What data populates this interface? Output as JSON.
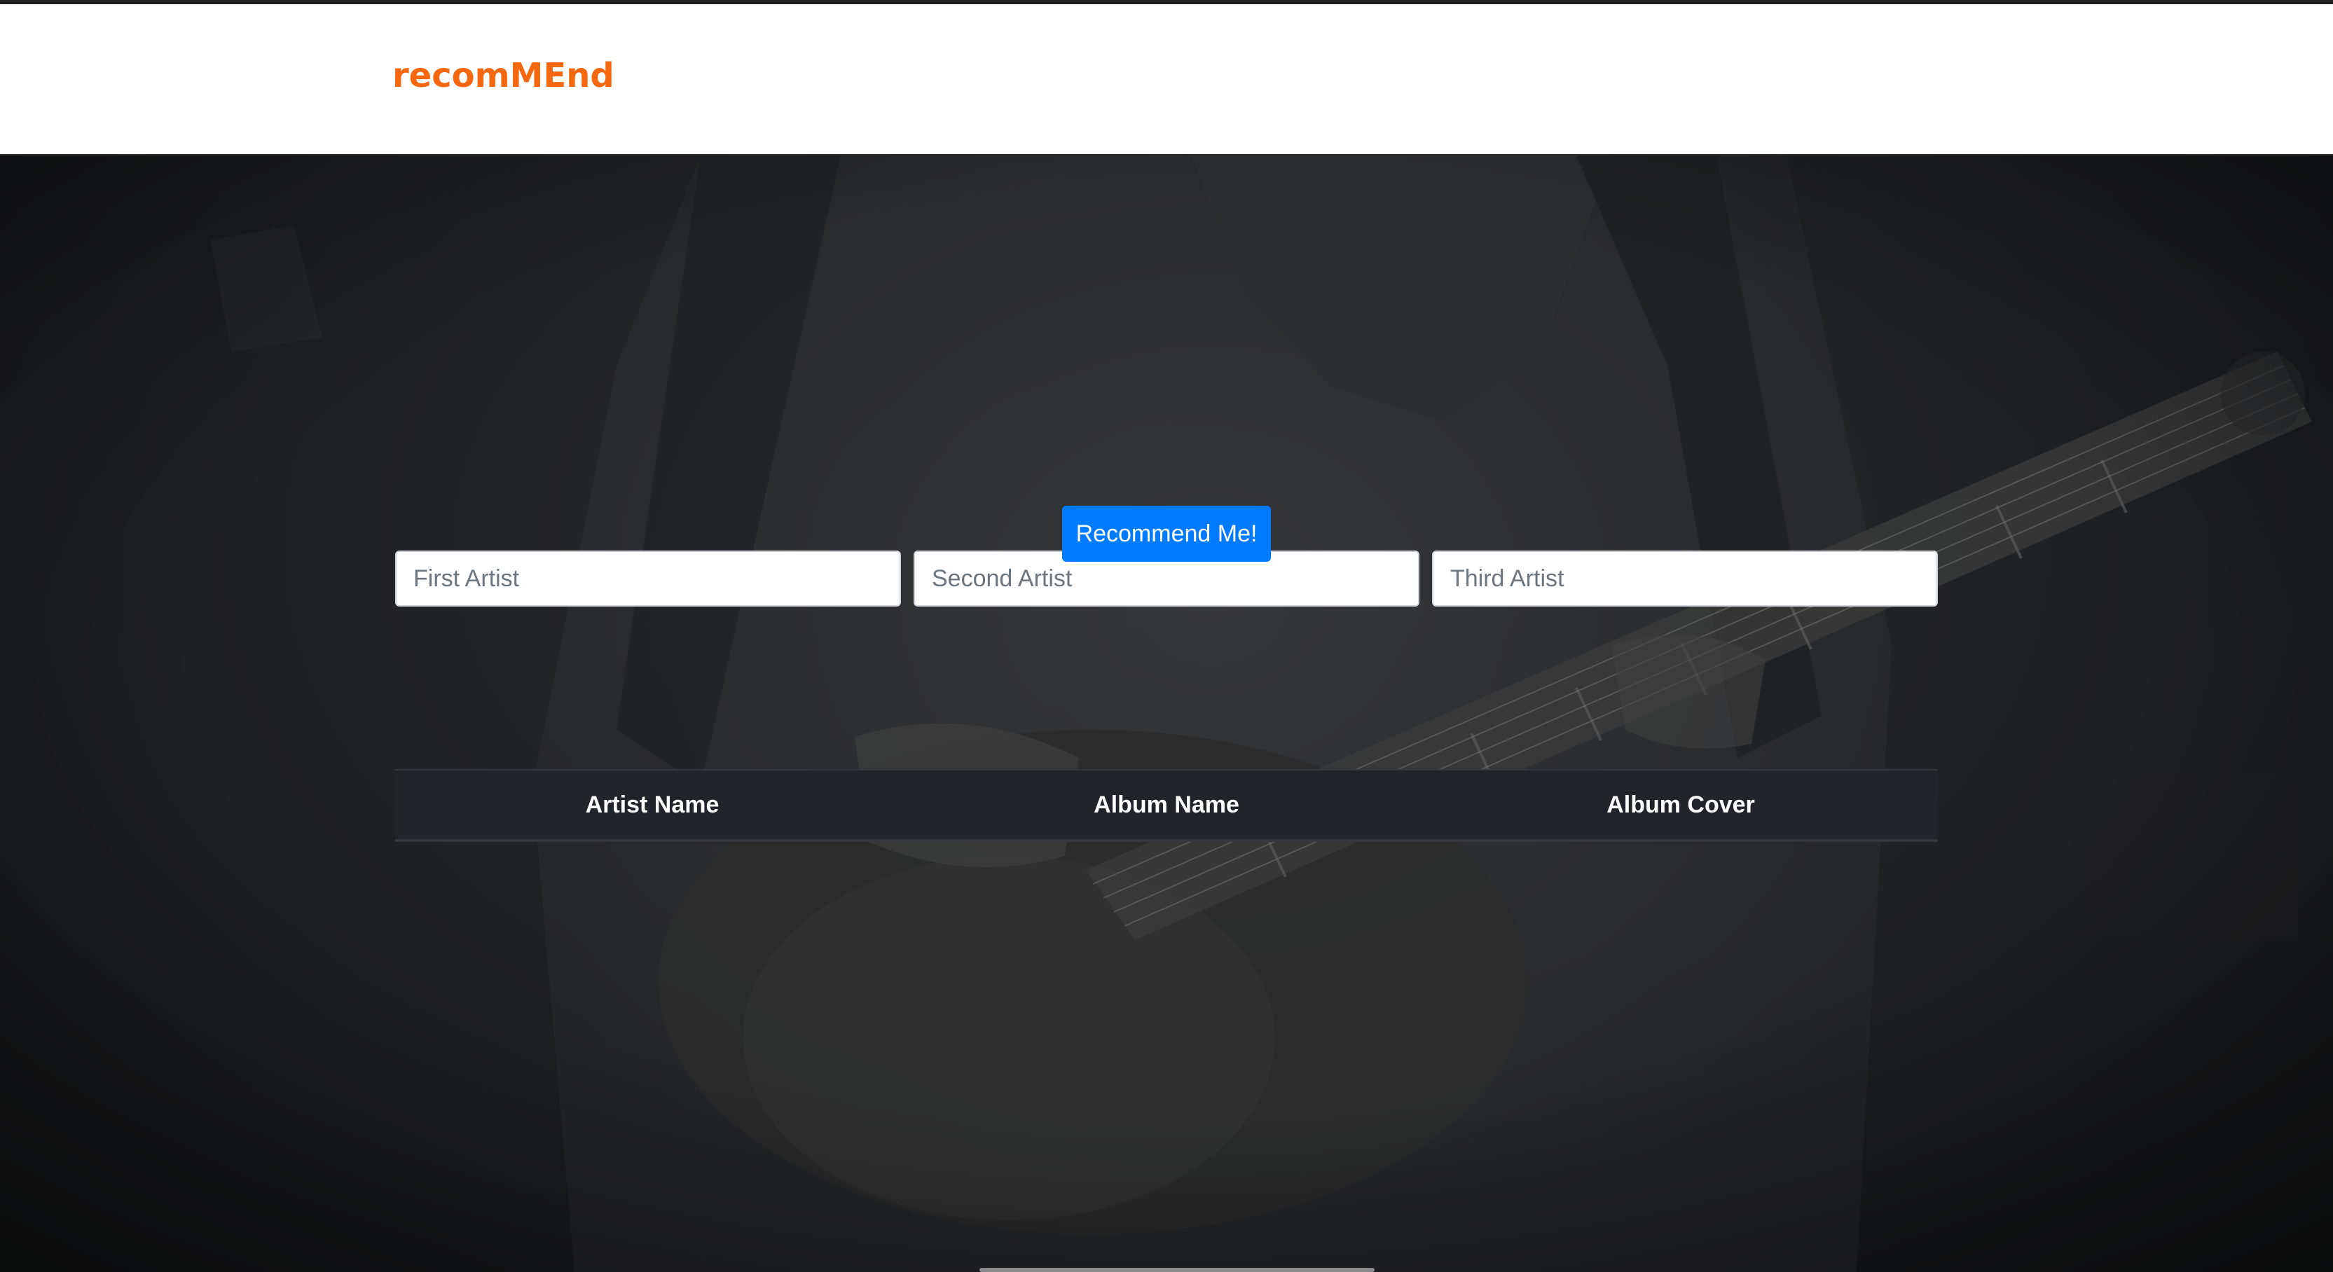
{
  "app": {
    "brand": "recomMEnd",
    "brand_color": "#f5680f",
    "accent_color": "#007bff"
  },
  "form": {
    "inputs": [
      {
        "placeholder": "First Artist",
        "value": ""
      },
      {
        "placeholder": "Second Artist",
        "value": ""
      },
      {
        "placeholder": "Third Artist",
        "value": ""
      }
    ],
    "submit_label": "Recommend Me!"
  },
  "results": {
    "columns": [
      "Artist Name",
      "Album Name",
      "Album Cover"
    ],
    "rows": []
  },
  "background": {
    "description_icon": "guitar-player-photo"
  }
}
